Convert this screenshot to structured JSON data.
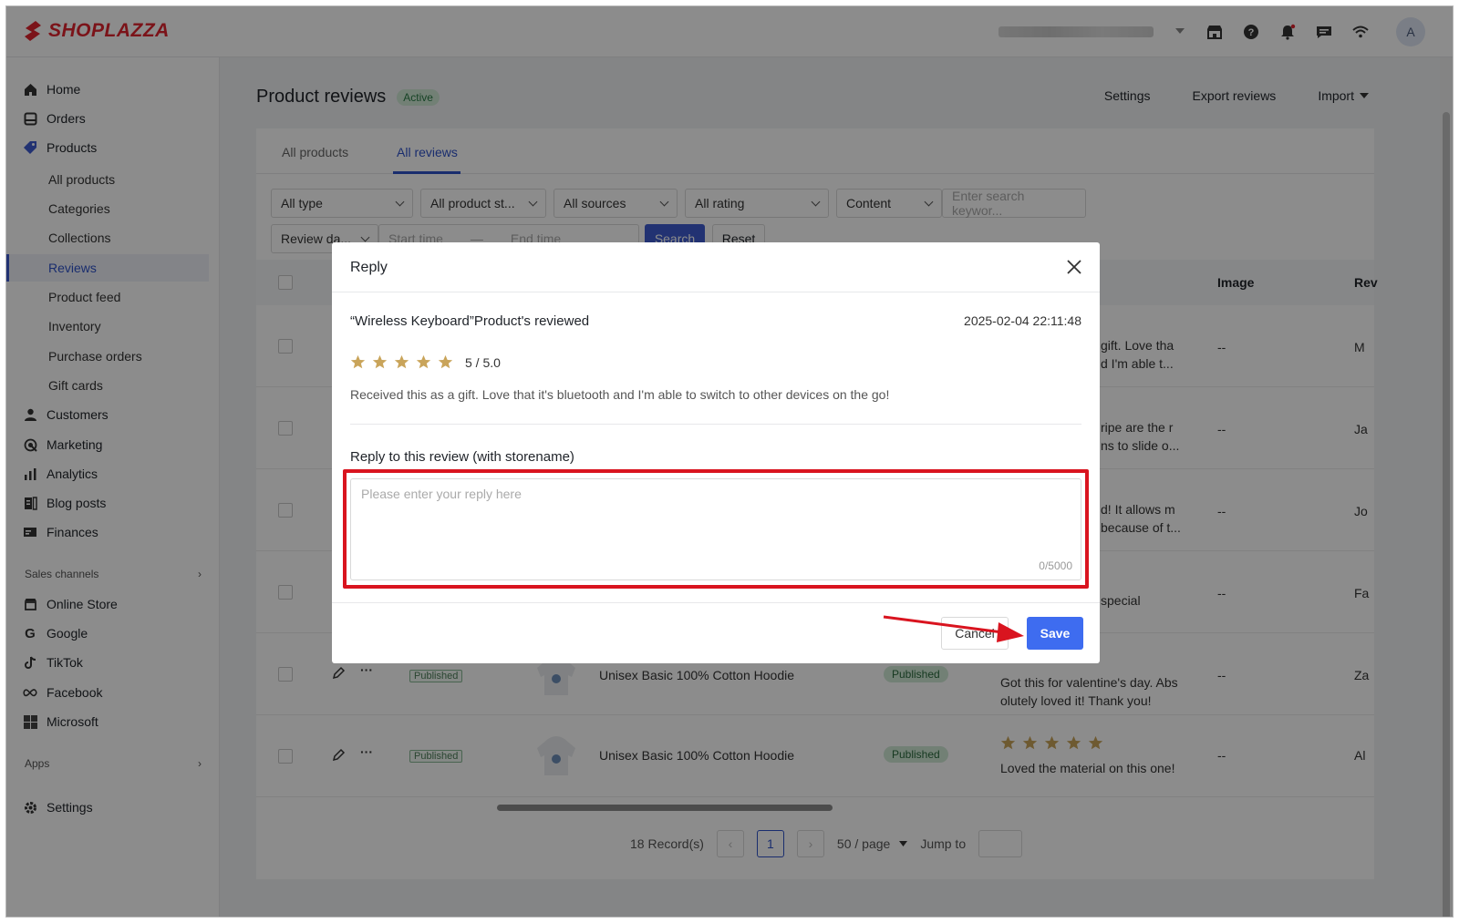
{
  "brand": {
    "name": "SHOPLAZZA",
    "color": "#e0242f"
  },
  "topbar": {
    "icons": [
      "store-icon",
      "help-icon",
      "bell-icon",
      "chat-icon",
      "wifi-icon"
    ],
    "avatar_initial": "A"
  },
  "sidebar": {
    "items": [
      {
        "label": "Home",
        "icon": "home-icon"
      },
      {
        "label": "Orders",
        "icon": "orders-icon"
      },
      {
        "label": "Products",
        "icon": "tag-icon"
      }
    ],
    "product_subitems": [
      "All products",
      "Categories",
      "Collections",
      "Reviews",
      "Product feed",
      "Inventory",
      "Purchase orders",
      "Gift cards"
    ],
    "active_subitem": "Reviews",
    "more_items": [
      {
        "label": "Customers",
        "icon": "user-icon"
      },
      {
        "label": "Marketing",
        "icon": "marketing-icon"
      },
      {
        "label": "Analytics",
        "icon": "analytics-icon"
      },
      {
        "label": "Blog posts",
        "icon": "blog-icon"
      },
      {
        "label": "Finances",
        "icon": "finances-icon"
      }
    ],
    "sales_channels_label": "Sales channels",
    "channels": [
      {
        "label": "Online Store",
        "icon": "store-icon"
      },
      {
        "label": "Google",
        "icon": "google-icon"
      },
      {
        "label": "TikTok",
        "icon": "tiktok-icon"
      },
      {
        "label": "Facebook",
        "icon": "meta-icon"
      },
      {
        "label": "Microsoft",
        "icon": "microsoft-icon"
      }
    ],
    "apps_label": "Apps",
    "settings_label": "Settings"
  },
  "page": {
    "title": "Product reviews",
    "status_badge": "Active",
    "actions": {
      "settings": "Settings",
      "export": "Export reviews",
      "import": "Import"
    },
    "tabs": [
      "All products",
      "All reviews"
    ],
    "active_tab": "All reviews",
    "filters": {
      "type": "All type",
      "product_status": "All product st...",
      "sources": "All sources",
      "rating": "All rating",
      "content": "Content",
      "search_placeholder": "Enter search keywor...",
      "date_type": "Review da...",
      "start_placeholder": "Start time",
      "range_separator": "—",
      "end_placeholder": "End time",
      "search_button": "Search",
      "reset_button": "Reset"
    },
    "table": {
      "columns": {
        "image": "Image",
        "review": "Rev"
      },
      "rows": [
        {
          "review_lines": [
            "gift. Love tha",
            "d I'm able t..."
          ],
          "image": "--",
          "reviewer": "M"
        },
        {
          "review_lines": [
            "ripe are the r",
            "ns to slide o..."
          ],
          "image": "--",
          "reviewer": "Ja"
        },
        {
          "review_lines": [
            "d! It allows m",
            "because of t..."
          ],
          "image": "--",
          "reviewer": "Jo"
        },
        {
          "review_lines": [
            "special"
          ],
          "image": "--",
          "reviewer": "Fa"
        },
        {
          "status_tag": "Published",
          "product": "Unisex Basic 100% Cotton Hoodie",
          "status_pill": "Published",
          "review_lines": [
            "Got this for valentine's day. Abs",
            "olutely loved it! Thank you!"
          ],
          "image": "--",
          "reviewer": "Za"
        },
        {
          "status_tag": "Published",
          "product": "Unisex Basic 100% Cotton Hoodie",
          "status_pill": "Published",
          "rating": 5,
          "review_lines": [
            "Loved the material on this one!"
          ],
          "image": "--",
          "reviewer": "Al"
        }
      ]
    },
    "pagination": {
      "records": "18 Record(s)",
      "current_page": "1",
      "page_size": "50 / page",
      "jump_label": "Jump to"
    }
  },
  "modal": {
    "title": "Reply",
    "product_line": "“Wireless Keyboard”Product's reviewed",
    "date": "2025-02-04 22:11:48",
    "rating": 5,
    "rating_text": "5 / 5.0",
    "review_text": "Received this as a gift. Love that it's bluetooth and I'm able to switch to other devices on the go!",
    "reply_label": "Reply to this review (with storename)",
    "reply_placeholder": "Please enter your reply here",
    "char_count": "0/5000",
    "cancel_label": "Cancel",
    "save_label": "Save"
  },
  "colors": {
    "primary": "#3e5ccf",
    "save": "#3e6cf0",
    "highlight": "#d9141f",
    "star": "#c9a45a"
  }
}
